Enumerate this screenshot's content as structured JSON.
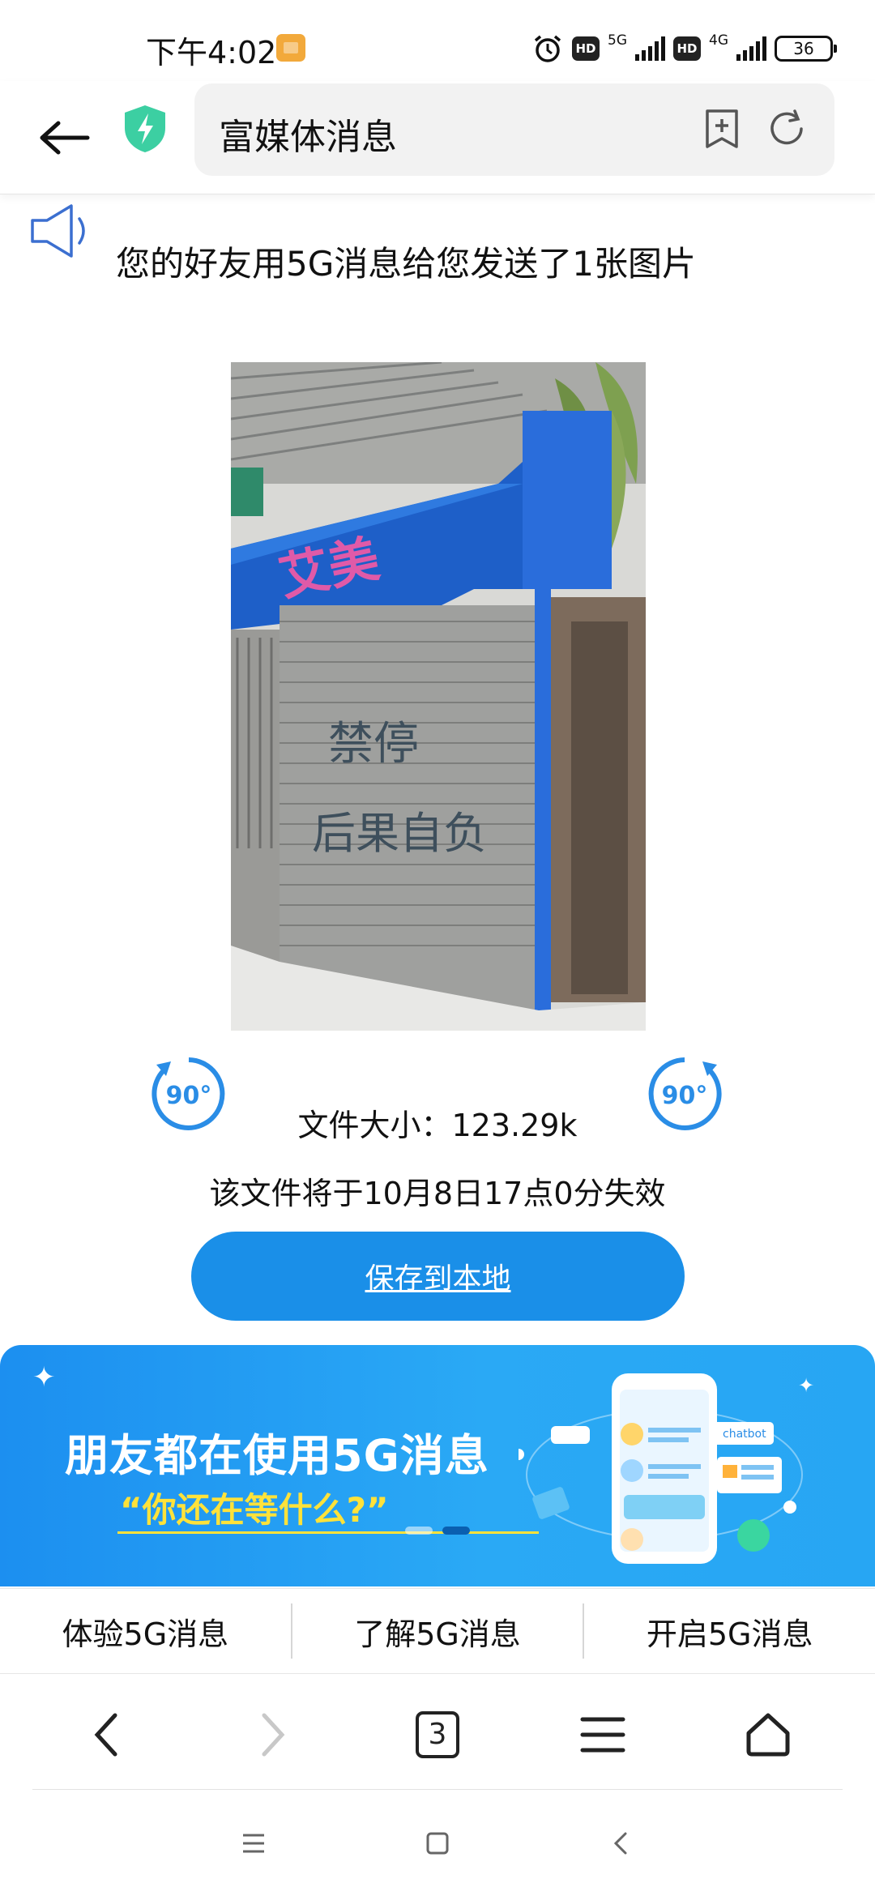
{
  "status_bar": {
    "time": "下午4:02",
    "hd1": "HD",
    "net1": "5G",
    "hd2": "HD",
    "net2": "4G",
    "battery": "36"
  },
  "address_bar": {
    "title": "富媒体消息"
  },
  "message": {
    "headline": "您的好友用5G消息给您发送了1张图片",
    "rotate_label": "90°",
    "file_size": "文件大小：123.29k",
    "expire_text": "该文件将于10月8日17点0分失效",
    "save_button": "保存到本地"
  },
  "photo": {
    "sign_text": "艾美",
    "graffiti_line1": "禁停",
    "graffiti_line2": "后果自负"
  },
  "banner": {
    "title": "朋友都在使用5G消息",
    "subtitle": "“你还在等什么?”",
    "chatbot_label": "chatbot"
  },
  "bottom_links": [
    "体验5G消息",
    "了解5G消息",
    "开启5G消息"
  ],
  "browser_nav": {
    "tab_count": "3"
  },
  "colors": {
    "accent": "#1a8fe8",
    "banner_highlight": "#ffe23a",
    "shield": "#3ccfa2"
  }
}
